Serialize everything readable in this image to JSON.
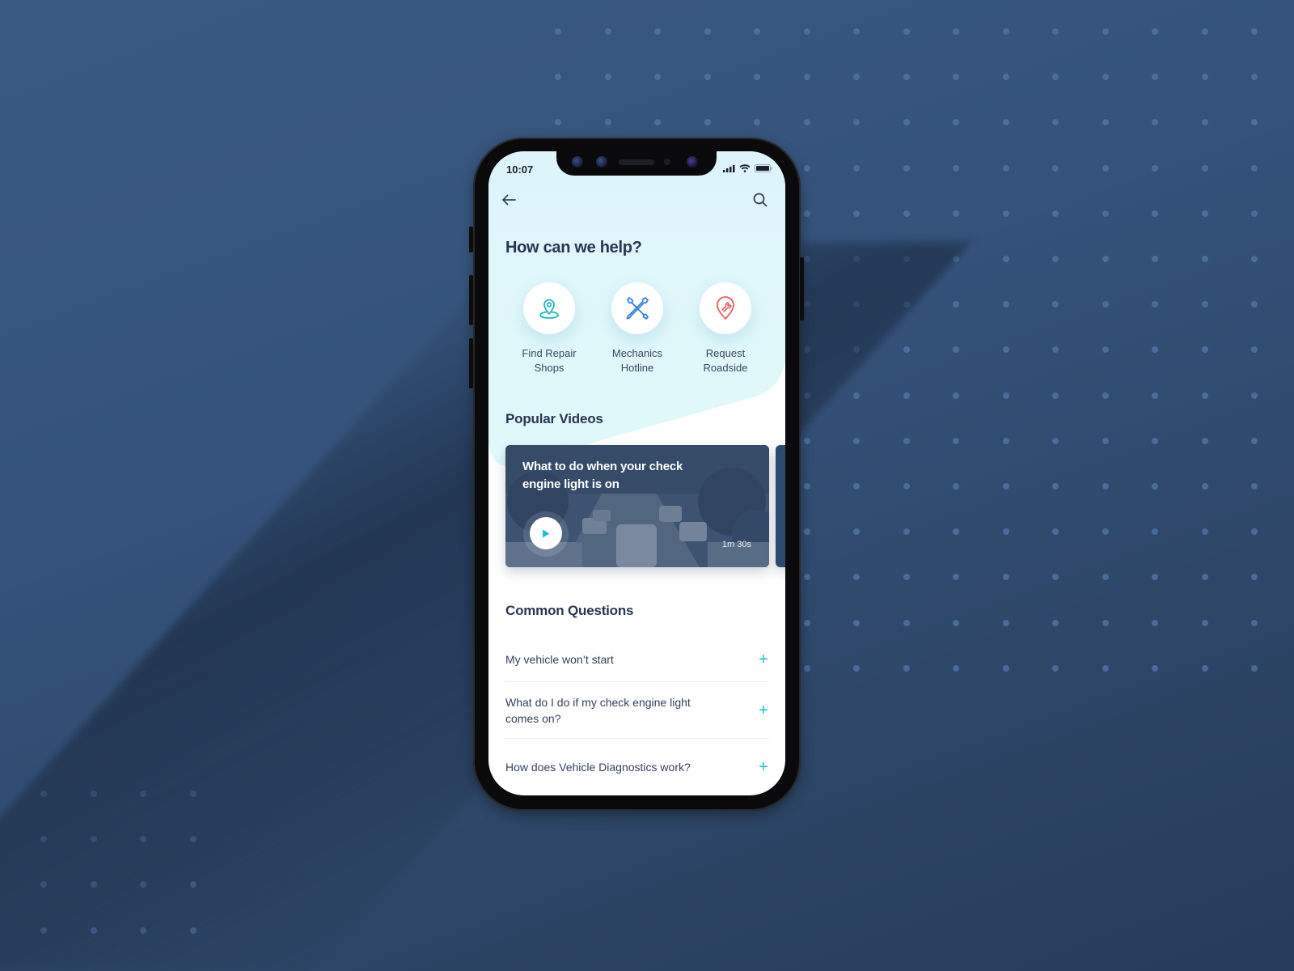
{
  "status_bar": {
    "time": "10:07",
    "icons": [
      "signal-icon",
      "wifi-icon",
      "battery-icon"
    ]
  },
  "topbar": {
    "back_icon": "arrow-left-icon",
    "search_icon": "search-icon"
  },
  "header": {
    "title": "How can we help?"
  },
  "quick_actions": [
    {
      "label": "Find Repair\nShops",
      "icon": "map-pin-icon",
      "color": "#1fbcc0"
    },
    {
      "label": "Mechanics\nHotline",
      "icon": "crossed-wrenches-icon",
      "color": "#2f7be0"
    },
    {
      "label": "Request\nRoadside",
      "icon": "wrench-pin-icon",
      "color": "#ec5a5a"
    }
  ],
  "videos": {
    "section_title": "Popular Videos",
    "items": [
      {
        "title": "What to do when your check engine light is on",
        "duration": "1m 30s"
      }
    ]
  },
  "faq": {
    "section_title": "Common Questions",
    "items": [
      {
        "question": "My vehicle won’t start"
      },
      {
        "question": "What do I do if my check engine light comes on?"
      },
      {
        "question": "How does Vehicle Diagnostics work?"
      }
    ],
    "expand_icon": "plus-icon"
  },
  "colors": {
    "accent": "#19c1c6",
    "text_dark": "#283650",
    "hero_bg": "#e0f6fb",
    "background": "#34527a"
  }
}
